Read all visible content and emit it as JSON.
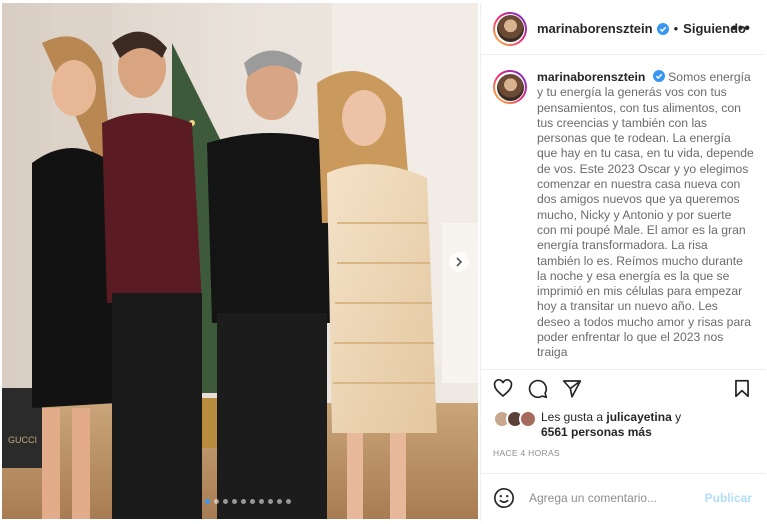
{
  "post": {
    "username": "marinaborensztein",
    "follow_status": "Siguiendo",
    "separator": "•",
    "more_glyph": "•••",
    "caption": "Somos energía y tu energía la generás vos con tus pensamientos, con tus alimentos, con tus creencias y también con las personas que te rodean. La energía que hay en tu casa, en tu vida, depende de vos. Este 2023 Oscar y yo elegimos comenzar en nuestra casa nueva con dos amigos nuevos que ya queremos mucho, Nicky y Antonio y por suerte con mi poupé Male. El amor es la gran energía transformadora. La risa también lo es. Reímos mucho durante la noche y esa energía es la que se imprimió en mis células para empezar hoy a transitar un nuevo año. Les deseo a todos mucho amor y risas para poder enfrentar lo que el 2023 nos traiga",
    "likes_prefix": "Les gusta a ",
    "likes_user": "julicayetina",
    "likes_connector": " y",
    "likes_count_text": "6561 personas más",
    "timestamp": "HACE 4 HORAS",
    "comment_placeholder": "Agrega un comentario...",
    "publish_label": "Publicar",
    "carousel": {
      "total": 10,
      "current": 1
    },
    "photo_watermark": "GUCCI"
  },
  "colors": {
    "verified": "#3897f0",
    "link_blue": "#b2dffc",
    "text": "#262626",
    "muted": "#8e8e8e"
  },
  "icons": {
    "like": "heart-icon",
    "comment": "comment-icon",
    "share": "paper-plane-icon",
    "save": "bookmark-icon",
    "emoji": "smiley-icon",
    "more": "more-options-icon",
    "verified": "verified-badge-icon",
    "next": "chevron-right-icon"
  }
}
